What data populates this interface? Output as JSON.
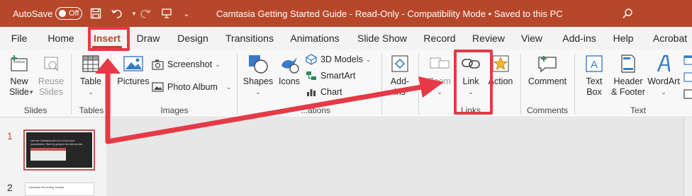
{
  "titlebar": {
    "autosave_label": "AutoSave",
    "autosave_state": "Off",
    "title": "Camtasia Getting Started Guide  -  Read-Only  -  Compatibility Mode • Saved to this PC",
    "chevron": "⌄"
  },
  "tabs": [
    "File",
    "Home",
    "Insert",
    "Draw",
    "Design",
    "Transitions",
    "Animations",
    "Slide Show",
    "Record",
    "Review",
    "View",
    "Add-ins",
    "Help",
    "Acrobat"
  ],
  "active_tab": "Insert",
  "ribbon": {
    "new_slide": "New\nSlide",
    "reuse_slides": "Reuse\nSlides",
    "slides_group": "Slides",
    "table": "Table",
    "tables_group": "Tables",
    "pictures": "Pictures",
    "screenshot": "Screenshot",
    "photo_album": "Photo Album",
    "images_group": "Images",
    "shapes": "Shapes",
    "icons": "Icons",
    "models_3d": "3D Models",
    "smartart": "SmartArt",
    "chart": "Chart",
    "illustrations_group": "...ations",
    "addins": "Add-\nins",
    "zoom": "Zoom",
    "link": "Link",
    "action": "Action",
    "links_group": "Links",
    "comment": "Comment",
    "comments_group": "Comments",
    "text_box": "Text\nBox",
    "header_footer": "Header\n& Footer",
    "wordart": "WordArt",
    "text_group": "Text"
  },
  "slides": {
    "one": "1",
    "two": "2",
    "thumb1_text": "Use the Camtasia add-in to record your presentation. Start by going to the Add-ins tab.",
    "thumb2_title": "Camtasia Recording Toolbar"
  },
  "colors": {
    "accent": "#b7472a",
    "annotation": "#e63946"
  }
}
